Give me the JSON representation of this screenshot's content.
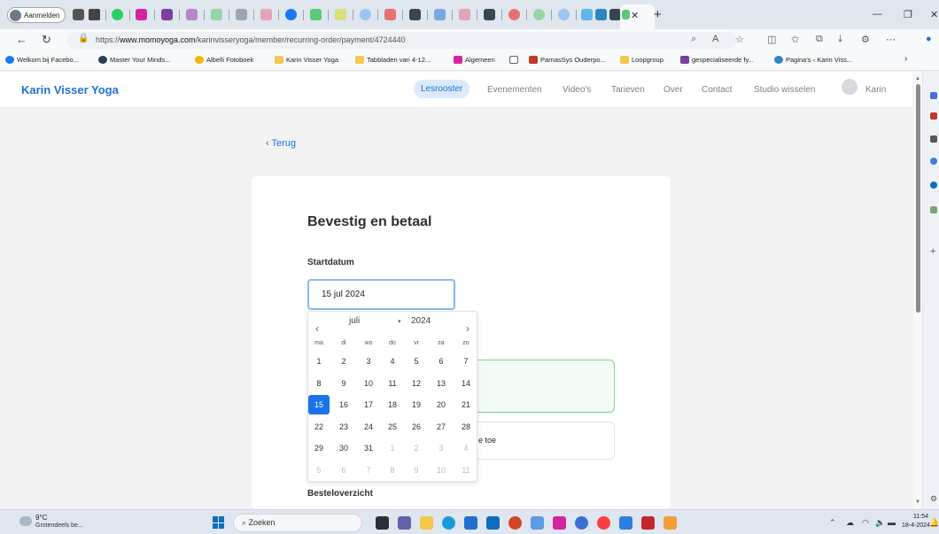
{
  "browser": {
    "profile_label": "Aanmelden",
    "url_prefix": "https://",
    "url_domain": "www.momoyoga.com",
    "url_path": "/karinvisseryoga/member/recurring-order/payment/4724440",
    "bookmarks": [
      {
        "label": "Welkom bij Facebo...",
        "color": "#1877f2"
      },
      {
        "label": "Master Your Minds...",
        "color": "#2b3a55"
      },
      {
        "label": "Albelli Fotoboek",
        "color": "#f5b400"
      },
      {
        "label": "Karin Visser Yoga",
        "color": "#f2c94c"
      },
      {
        "label": "Tabbladen van 4-12...",
        "color": "#f2c94c"
      },
      {
        "label": "Algemeen",
        "color": "#d6249f"
      },
      {
        "label": "",
        "color": "#666666"
      },
      {
        "label": "ParnasSys Ouderpo...",
        "color": "#c0392b"
      },
      {
        "label": "Loopgroup",
        "color": "#f2c94c"
      },
      {
        "label": "gespecialiseerde fy...",
        "color": "#7b3fa0"
      },
      {
        "label": "Pagina's ‹ Karin Viss...",
        "color": "#2e86c1"
      }
    ]
  },
  "site": {
    "brand": "Karin Visser Yoga",
    "nav": {
      "lesrooster": "Lesrooster",
      "evenementen": "Evenementen",
      "videos": "Video's",
      "tarieven": "Tarieven",
      "over": "Over",
      "contact": "Contact",
      "studio": "Studio wisselen",
      "user": "Karin"
    },
    "accent": "#1a73d8"
  },
  "checkout": {
    "back": "Terug",
    "title": "Bevestig en betaal",
    "start_label": "Startdatum",
    "start_value": "15 jul 2024",
    "option_text": "e toe",
    "order_label": "Besteloverzicht"
  },
  "calendar": {
    "month": "juli",
    "year": "2024",
    "weekdays": [
      "ma",
      "di",
      "wo",
      "do",
      "vr",
      "za",
      "zo"
    ],
    "rows": [
      [
        "1",
        "2",
        "3",
        "4",
        "5",
        "6",
        "7"
      ],
      [
        "8",
        "9",
        "10",
        "11",
        "12",
        "13",
        "14"
      ],
      [
        "15",
        "16",
        "17",
        "18",
        "19",
        "20",
        "21"
      ],
      [
        "22",
        "23",
        "24",
        "25",
        "26",
        "27",
        "28"
      ],
      [
        "29",
        "30",
        "31",
        "1",
        "2",
        "3",
        "4"
      ],
      [
        "5",
        "6",
        "7",
        "8",
        "9",
        "10",
        "11"
      ]
    ],
    "selected": "15",
    "selected_color": "#1a73e8"
  },
  "taskbar": {
    "temp": "9°C",
    "weather": "Grotendeels be...",
    "search": "Zoeken",
    "time": "11:54",
    "date": "18-4-2024"
  }
}
